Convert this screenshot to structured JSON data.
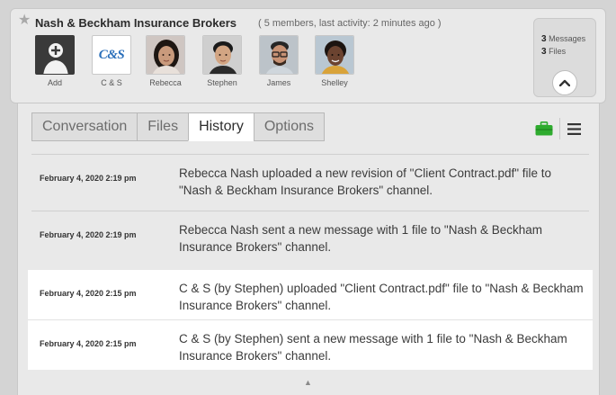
{
  "channel": {
    "title": "Nash & Beckham Insurance Brokers",
    "meta": "( 5 members, last activity: 2 minutes ago )",
    "messages_count": "3",
    "messages_label": "Messages",
    "files_count": "3",
    "files_label": "Files"
  },
  "members": [
    {
      "label": "Add",
      "icon": "add-member-icon"
    },
    {
      "label": "C & S",
      "logo_text": "C&S"
    },
    {
      "label": "Rebecca"
    },
    {
      "label": "Stephen"
    },
    {
      "label": "James"
    },
    {
      "label": "Shelley"
    }
  ],
  "tabs": [
    {
      "label": "Conversation"
    },
    {
      "label": "Files"
    },
    {
      "label": "History",
      "active": true
    },
    {
      "label": "Options"
    }
  ],
  "history": [
    {
      "date": "February 4, 2020 2:19 pm",
      "text": "Rebecca Nash uploaded a new revision of \"Client Contract.pdf\" file to \"Nash & Beckham Insurance Brokers\" channel."
    },
    {
      "date": "February 4, 2020 2:19 pm",
      "text": "Rebecca Nash sent a new message with 1 file to \"Nash & Beckham Insurance Brokers\" channel."
    },
    {
      "date": "February 4, 2020 2:15 pm",
      "text": "C & S (by Stephen) uploaded \"Client Contract.pdf\" file to \"Nash & Beckham Insurance Brokers\" channel."
    },
    {
      "date": "February 4, 2020 2:15 pm",
      "text": "C & S (by Stephen) sent a new message with 1 file to \"Nash & Beckham Insurance Brokers\" channel."
    }
  ],
  "colors": {
    "accent_green": "#2eab2e",
    "logo_blue": "#2a6fba"
  }
}
